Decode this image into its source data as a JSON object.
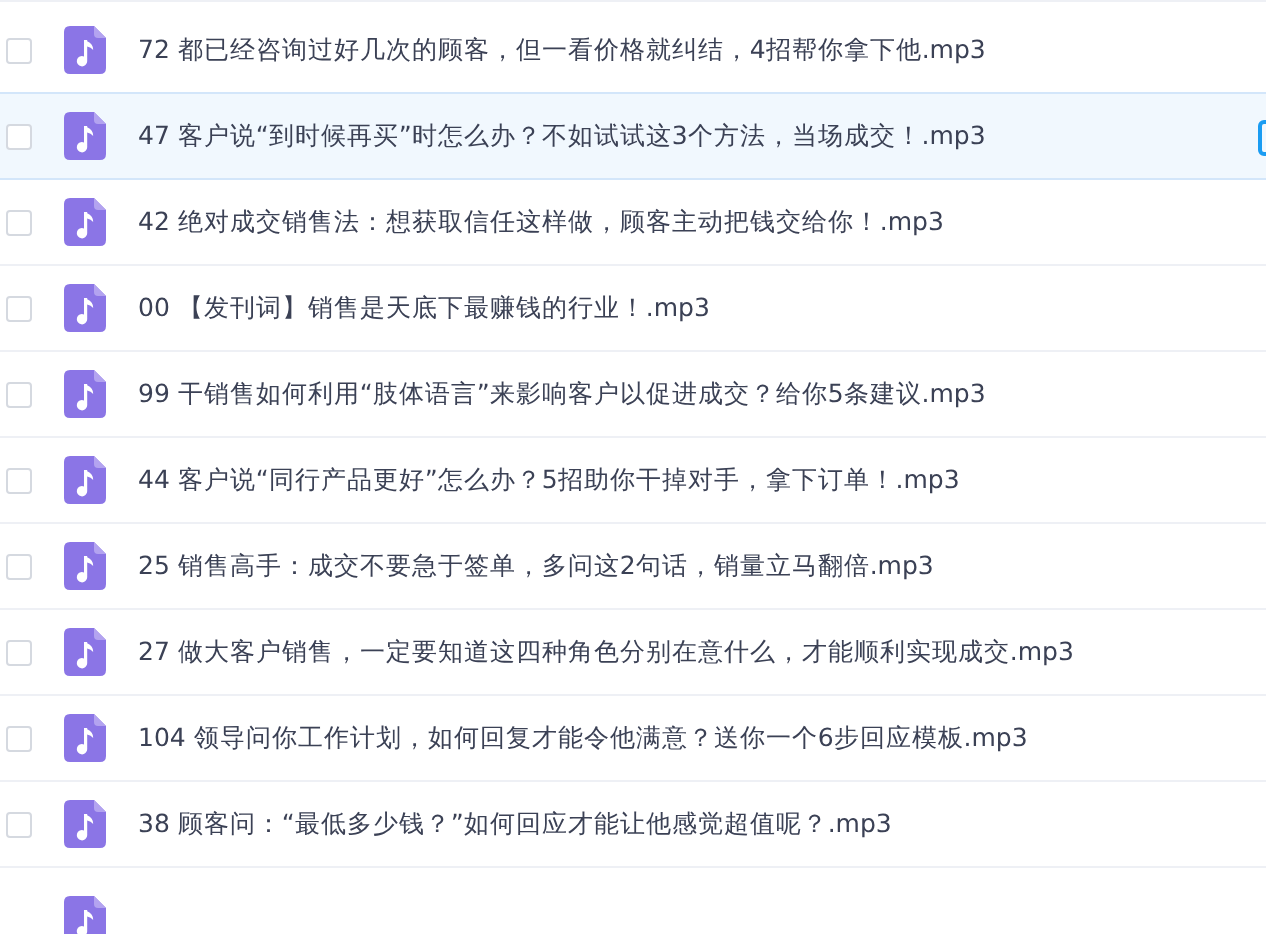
{
  "files": [
    {
      "kind": "file",
      "name": "72 都已经咨询过好几次的顾客，但一看价格就纠结，4招帮你拿下他.mp3",
      "checked": false,
      "hovered": false
    },
    {
      "kind": "file",
      "name": "47 客户说“到时候再买”时怎么办？不如试试这3个方法，当场成交！.mp3",
      "checked": false,
      "hovered": true
    },
    {
      "kind": "file",
      "name": "42 绝对成交销售法：想获取信任这样做，顾客主动把钱交给你！.mp3",
      "checked": false,
      "hovered": false
    },
    {
      "kind": "file",
      "name": "00 【发刊词】销售是天底下最赚钱的行业！.mp3",
      "checked": false,
      "hovered": false
    },
    {
      "kind": "file",
      "name": "99 干销售如何利用“肢体语言”来影响客户以促进成交？给你5条建议.mp3",
      "checked": false,
      "hovered": false
    },
    {
      "kind": "file",
      "name": "44 客户说“同行产品更好”怎么办？5招助你干掉对手，拿下订单！.mp3",
      "checked": false,
      "hovered": false
    },
    {
      "kind": "file",
      "name": "25 销售高手：成交不要急于签单，多问这2句话，销量立马翻倍.mp3",
      "checked": false,
      "hovered": false
    },
    {
      "kind": "file",
      "name": "27 做大客户销售，一定要知道这四种角色分别在意什么，才能顺利实现成交.mp3",
      "checked": false,
      "hovered": false
    },
    {
      "kind": "file",
      "name": "104 领导问你工作计划，如何回复才能令他满意？送你一个6步回应模板.mp3",
      "checked": false,
      "hovered": false
    },
    {
      "kind": "file",
      "name": "38 顾客问：“最低多少钱？”如何回应才能让他感觉超值呢？.mp3",
      "checked": false,
      "hovered": false
    },
    {
      "kind": "cut"
    }
  ]
}
